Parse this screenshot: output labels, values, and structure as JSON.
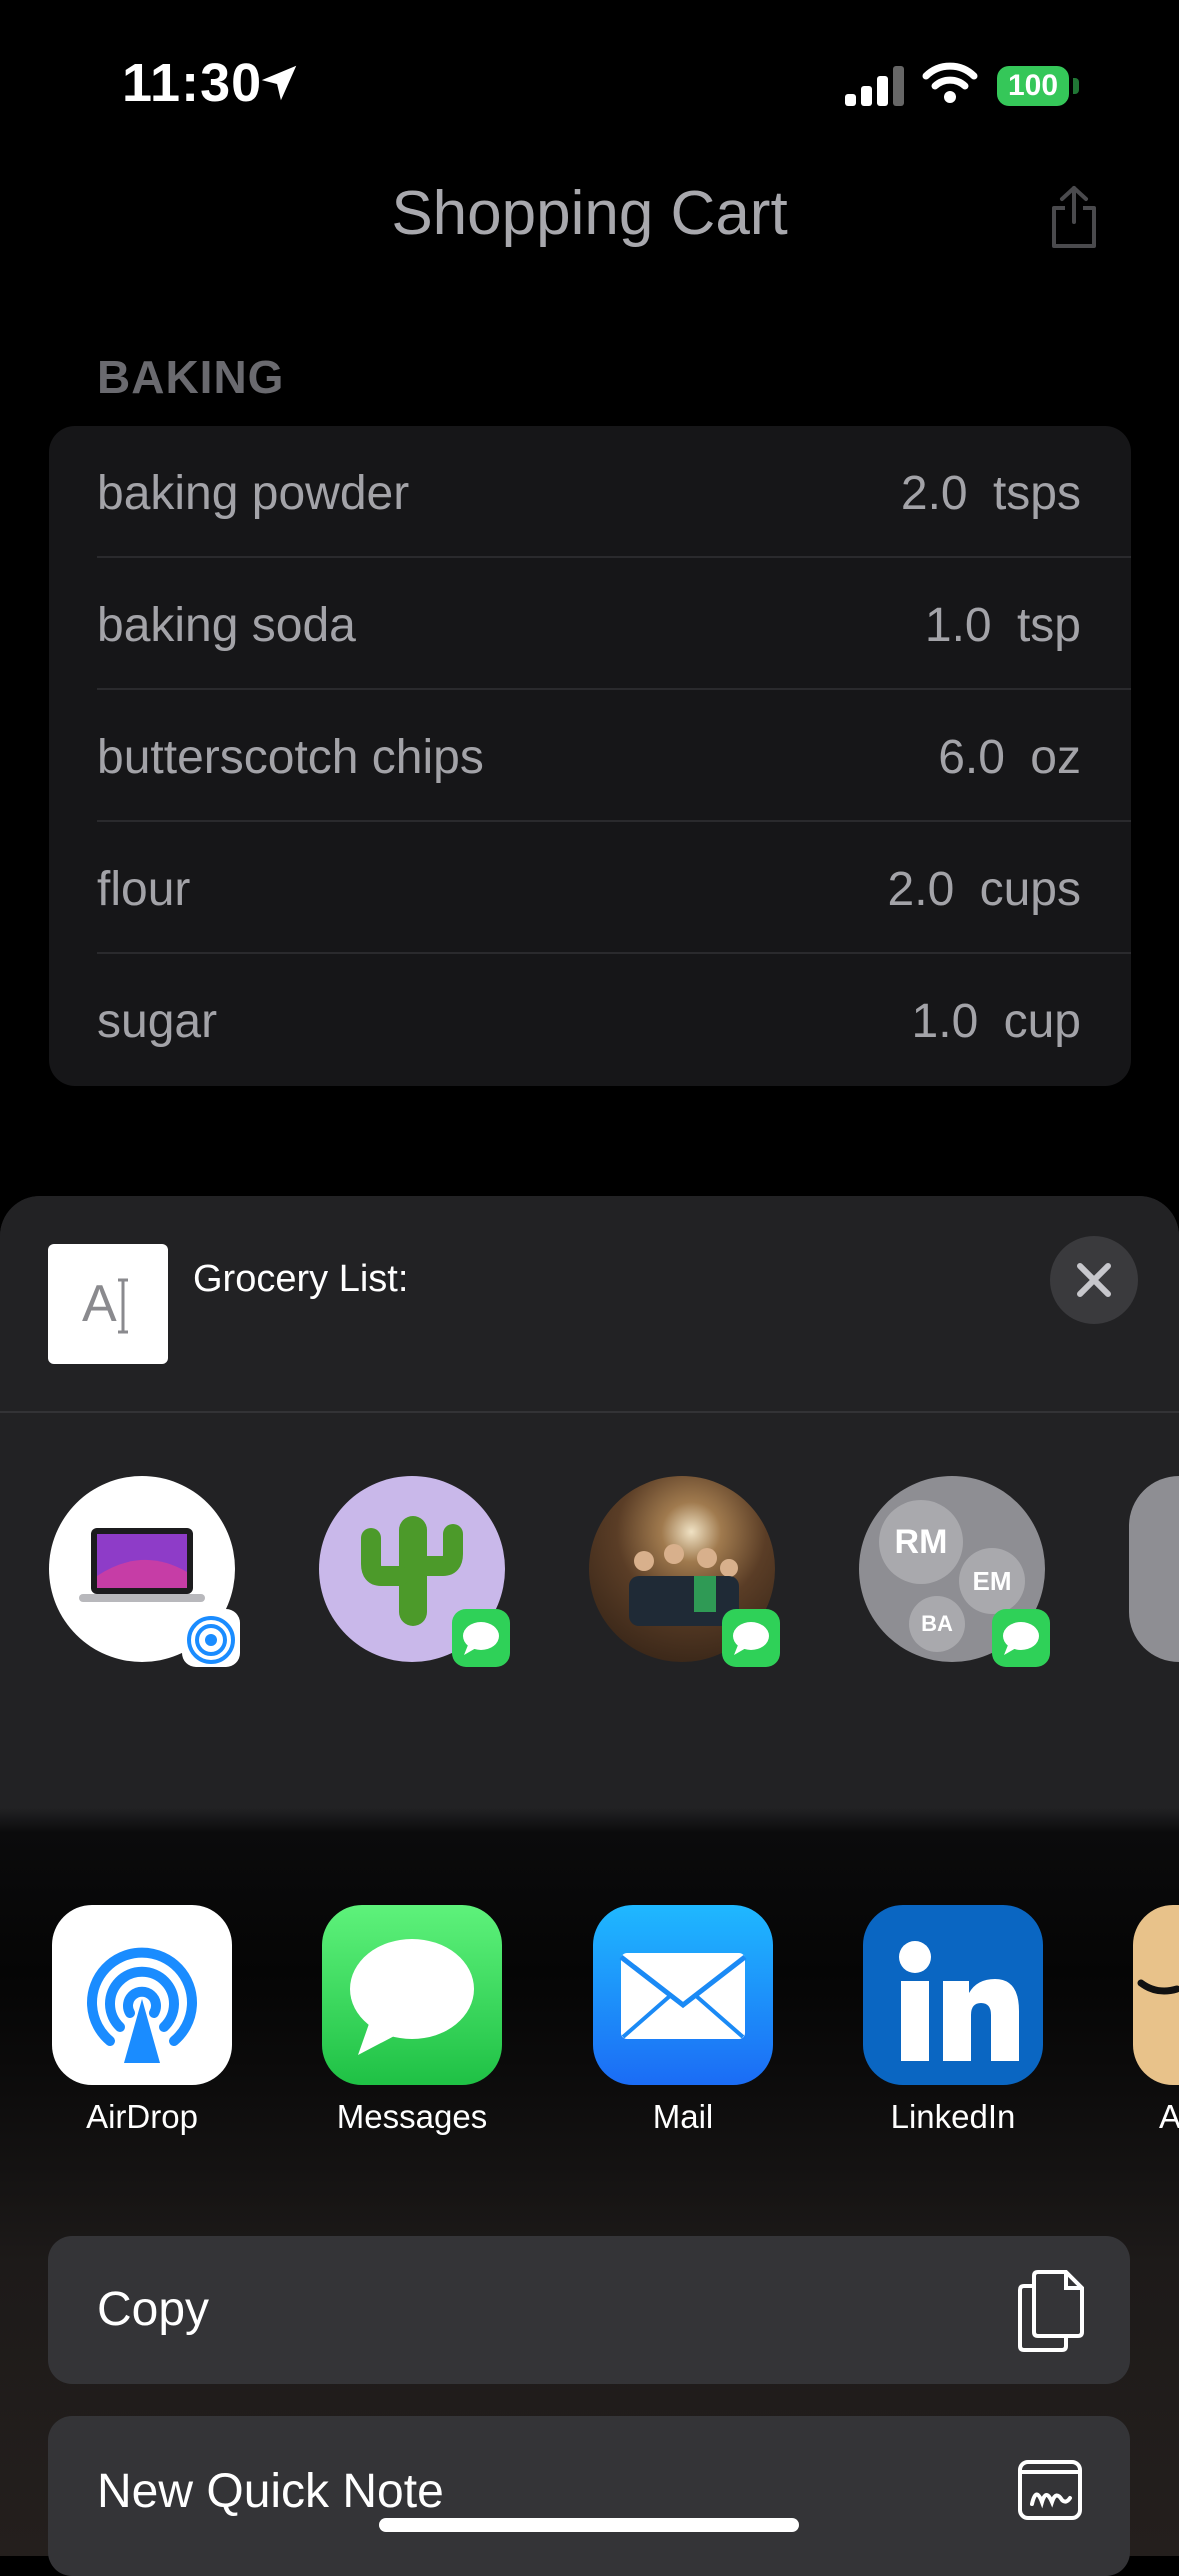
{
  "status_bar": {
    "time": "11:30",
    "battery": "100"
  },
  "nav": {
    "title": "Shopping Cart"
  },
  "section": {
    "header": "BAKING"
  },
  "items": [
    {
      "name": "baking powder",
      "quantity": "2.0",
      "unit": "tsps"
    },
    {
      "name": "baking soda",
      "quantity": "1.0",
      "unit": "tsp"
    },
    {
      "name": "butterscotch chips",
      "quantity": "6.0",
      "unit": "oz"
    },
    {
      "name": "flour",
      "quantity": "2.0",
      "unit": "cups"
    },
    {
      "name": "sugar",
      "quantity": "1.0",
      "unit": "cup"
    }
  ],
  "share_sheet": {
    "preview_title": "Grocery List:",
    "preview_icon_text": "A",
    "contacts": [
      {
        "icon": "macbook-icon",
        "badge": "airdrop-icon"
      },
      {
        "icon": "cactus-icon",
        "badge": "messages-icon"
      },
      {
        "icon": "group-photo-avatar",
        "badge": "messages-icon"
      },
      {
        "initials": [
          "RM",
          "EM",
          "BA"
        ],
        "badge": "messages-icon"
      }
    ],
    "apps": [
      {
        "label": "AirDrop",
        "icon": "airdrop-icon"
      },
      {
        "label": "Messages",
        "icon": "messages-icon"
      },
      {
        "label": "Mail",
        "icon": "mail-icon"
      },
      {
        "label": "LinkedIn",
        "icon": "linkedin-icon"
      },
      {
        "label": "A",
        "icon": "amazon-icon"
      }
    ],
    "actions": [
      {
        "label": "Copy",
        "icon": "copy-icon"
      },
      {
        "label": "New Quick Note",
        "icon": "quick-note-icon"
      }
    ]
  }
}
